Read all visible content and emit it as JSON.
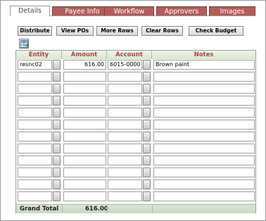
{
  "tabs": [
    {
      "label": "Details",
      "active": true
    },
    {
      "label": "Payee Info",
      "active": false
    },
    {
      "label": "Workflow",
      "active": false
    },
    {
      "label": "Approvers",
      "active": false
    },
    {
      "label": "Images",
      "active": false
    }
  ],
  "toolbar": {
    "distribute": "Distribute",
    "view_pos": "View POs",
    "more_rows": "More Rows",
    "clear_rows": "Clear Rows",
    "check_budget": "Check Budget"
  },
  "icons": {
    "export": "spreadsheet-export-icon",
    "lookup": "lookup-button"
  },
  "colors": {
    "tab_bg": "#b25d5a",
    "header_text": "#b5403e",
    "grid_header_bg": "#d9e6d2"
  },
  "grid": {
    "columns": [
      "Entity",
      "Amount",
      "Account",
      "Notes"
    ],
    "rows": [
      {
        "entity": "resnc02",
        "amount": "616.00",
        "account": "6015-0000",
        "notes": "Brown paint"
      },
      {
        "entity": "",
        "amount": "",
        "account": "",
        "notes": ""
      },
      {
        "entity": "",
        "amount": "",
        "account": "",
        "notes": ""
      },
      {
        "entity": "",
        "amount": "",
        "account": "",
        "notes": ""
      },
      {
        "entity": "",
        "amount": "",
        "account": "",
        "notes": ""
      },
      {
        "entity": "",
        "amount": "",
        "account": "",
        "notes": ""
      },
      {
        "entity": "",
        "amount": "",
        "account": "",
        "notes": ""
      },
      {
        "entity": "",
        "amount": "",
        "account": "",
        "notes": ""
      },
      {
        "entity": "",
        "amount": "",
        "account": "",
        "notes": ""
      },
      {
        "entity": "",
        "amount": "",
        "account": "",
        "notes": ""
      },
      {
        "entity": "",
        "amount": "",
        "account": "",
        "notes": ""
      },
      {
        "entity": "",
        "amount": "",
        "account": "",
        "notes": ""
      }
    ],
    "total_label": "Grand Total",
    "total_amount": "616.00"
  }
}
